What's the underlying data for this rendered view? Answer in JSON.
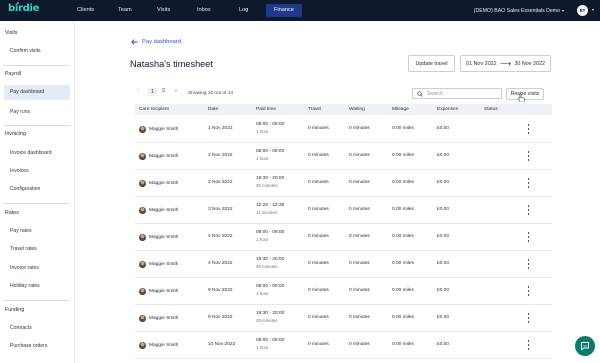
{
  "nav": {
    "logo": "birdie",
    "items": [
      "Clients",
      "Team",
      "Visits",
      "Inbox",
      "Log",
      "Finance"
    ],
    "active": "Finance",
    "org_name": "(DEMO) BAO Sales Essentials Demo",
    "avatar_initials": "ET"
  },
  "sidebar": {
    "sections": [
      {
        "title": "Visits",
        "items": [
          "Confirm visits"
        ]
      },
      {
        "title": "Payroll",
        "items": [
          "Pay dashboard",
          "Pay runs"
        ]
      },
      {
        "title": "Invoicing",
        "items": [
          "Invoice dashboard",
          "Invoices",
          "Configuration"
        ]
      },
      {
        "title": "Rates",
        "items": [
          "Pay rates",
          "Travel rates",
          "Invoice rates",
          "Holiday rates"
        ]
      },
      {
        "title": "Funding",
        "items": [
          "Contracts",
          "Purchase orders"
        ]
      }
    ],
    "active_item": "Pay dashboard"
  },
  "main": {
    "back_label": "Pay dashboard",
    "title": "Natasha's timesheet",
    "update_button": "Update travel",
    "date_from": "01 Nov 2022",
    "date_to": "30 Nov 2022",
    "pagination": {
      "pages": [
        "1",
        "2"
      ],
      "current": "1",
      "showing": "Showing 10 out of 14"
    },
    "search_placeholder": "Search",
    "resize_button": "Resize visits",
    "columns": [
      "Care recipient",
      "Date",
      "Paid time",
      "Travel",
      "Waiting",
      "Mileage",
      "Expenses",
      "Status"
    ],
    "rows": [
      {
        "recipient": "Maggie Smith",
        "date": "1 Nov 2022",
        "time": "08:00 - 09:00",
        "duration": "1 hour",
        "travel": "0 minutes",
        "waiting": "0 minutes",
        "mileage": "0.00 miles",
        "expenses": "£0.00",
        "status": ""
      },
      {
        "recipient": "Maggie Smith",
        "date": "2 Nov 2022",
        "time": "08:00 - 09:00",
        "duration": "1 hour",
        "travel": "0 minutes",
        "waiting": "0 minutes",
        "mileage": "0.00 miles",
        "expenses": "£0.00",
        "status": ""
      },
      {
        "recipient": "Maggie Smith",
        "date": "2 Nov 2022",
        "time": "19:30 - 20:00",
        "duration": "30 minutes",
        "travel": "0 minutes",
        "waiting": "0 minutes",
        "mileage": "0.00 miles",
        "expenses": "£0.00",
        "status": ""
      },
      {
        "recipient": "Maggie Smith",
        "date": "3 Nov 2022",
        "time": "12:25 - 12:36",
        "duration": "11 minutes",
        "travel": "0 minutes",
        "waiting": "0 minutes",
        "mileage": "0.00 miles",
        "expenses": "£0.00",
        "status": ""
      },
      {
        "recipient": "Maggie Smith",
        "date": "4 Nov 2022",
        "time": "08:00 - 09:00",
        "duration": "1 hour",
        "travel": "0 minutes",
        "waiting": "0 minutes",
        "mileage": "0.00 miles",
        "expenses": "£0.00",
        "status": ""
      },
      {
        "recipient": "Maggie Smith",
        "date": "4 Nov 2022",
        "time": "19:30 - 20:00",
        "duration": "30 minutes",
        "travel": "0 minutes",
        "waiting": "0 minutes",
        "mileage": "0.00 miles",
        "expenses": "£0.00",
        "status": ""
      },
      {
        "recipient": "Maggie Smith",
        "date": "9 Nov 2022",
        "time": "08:00 - 09:00",
        "duration": "1 hour",
        "travel": "0 minutes",
        "waiting": "0 minutes",
        "mileage": "0.00 miles",
        "expenses": "£0.00",
        "status": ""
      },
      {
        "recipient": "Maggie Smith",
        "date": "9 Nov 2022",
        "time": "19:30 - 20:00",
        "duration": "30 minutes",
        "travel": "0 minutes",
        "waiting": "0 minutes",
        "mileage": "0.00 miles",
        "expenses": "£0.00",
        "status": ""
      },
      {
        "recipient": "Maggie Smith",
        "date": "10 Nov 2022",
        "time": "08:00 - 09:00",
        "duration": "1 hour",
        "travel": "0 minutes",
        "waiting": "0 minutes",
        "mileage": "0.00 miles",
        "expenses": "£0.00",
        "status": ""
      }
    ]
  },
  "icons": {
    "back": "arrow-left-icon",
    "search": "search-icon",
    "more": "kebab-icon",
    "chat": "chat-icon"
  },
  "colors": {
    "nav_bg": "#0e1a2b",
    "accent": "#2752c9",
    "sidebar_active_bg": "#e3ebf9",
    "chat_bg": "#0c7a6a"
  }
}
